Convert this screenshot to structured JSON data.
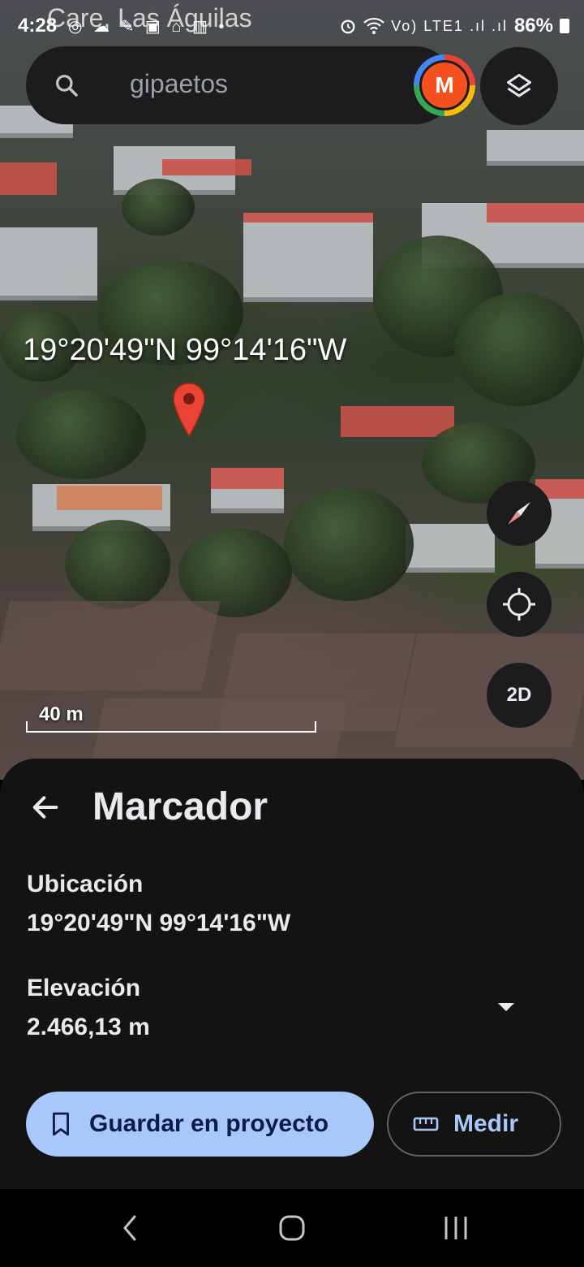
{
  "status_bar": {
    "time": "4:28",
    "overlay_text": "Care, Las Águilas",
    "notification_icons": "◎ ☁ ✎ ▣ ⌂ ▥ •",
    "network": "Vo) LTE1 .ıl .ıl",
    "battery": "86%"
  },
  "search": {
    "query": "gipaetos",
    "avatar_letter": "M"
  },
  "map": {
    "coordinates": "19°20'49\"N 99°14'16\"W",
    "scale_label": "40 m",
    "view_mode_button": "2D"
  },
  "sheet": {
    "title": "Marcador",
    "location_label": "Ubicación",
    "location_value": "19°20'49\"N 99°14'16\"W",
    "elevation_label": "Elevación",
    "elevation_value": "2.466,13 m",
    "save_button": "Guardar en proyecto",
    "measure_button": "Medir"
  },
  "colors": {
    "accent": "#a8c7fa",
    "pin": "#ea4335",
    "avatar": "#f4511e",
    "sheet_bg": "#131314"
  },
  "icons": [
    "search-icon",
    "layers-icon",
    "compass-icon",
    "my-location-icon",
    "back-arrow-icon",
    "chevron-down-icon",
    "bookmark-icon",
    "ruler-icon",
    "nav-back-icon",
    "nav-home-icon",
    "nav-recents-icon"
  ]
}
